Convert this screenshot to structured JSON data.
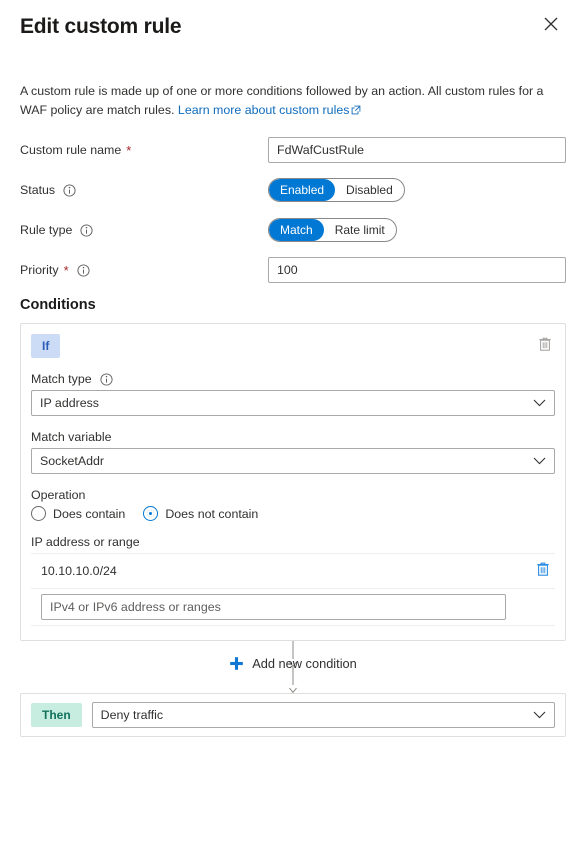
{
  "header": {
    "title": "Edit custom rule",
    "close_icon": "close-icon"
  },
  "intro": {
    "text_before": "A custom rule is made up of one or more conditions followed by an action. All custom rules for a WAF policy are match rules. ",
    "link_text": "Learn more about custom rules",
    "link_icon": "external-link-icon"
  },
  "form": {
    "rule_name": {
      "label": "Custom rule name",
      "required": "*",
      "value": "FdWafCustRule",
      "placeholder": ""
    },
    "status": {
      "label": "Status",
      "info_icon": "info-icon",
      "options": [
        "Enabled",
        "Disabled"
      ],
      "selected": "Enabled"
    },
    "rule_type": {
      "label": "Rule type",
      "info_icon": "info-icon",
      "options": [
        "Match",
        "Rate limit"
      ],
      "selected": "Match"
    },
    "priority": {
      "label": "Priority",
      "required": "*",
      "info_icon": "info-icon",
      "value": "100"
    }
  },
  "conditions": {
    "section_title": "Conditions",
    "if_badge": "If",
    "delete_icon": "trash-icon",
    "match_type": {
      "label": "Match type",
      "info_icon": "info-icon",
      "value": "IP address"
    },
    "match_variable": {
      "label": "Match variable",
      "value": "SocketAddr"
    },
    "operation": {
      "label": "Operation",
      "options": [
        "Does contain",
        "Does not contain"
      ],
      "selected": "Does not contain"
    },
    "ip_addresses": {
      "label": "IP address or range",
      "items": [
        "10.10.10.0/24"
      ],
      "item_delete_icon": "trash-icon",
      "new_placeholder": "IPv4 or IPv6 address or ranges",
      "new_value": ""
    }
  },
  "add_condition": {
    "label": "Add new condition",
    "icon": "plus-icon"
  },
  "then": {
    "badge": "Then",
    "action": "Deny traffic"
  },
  "colors": {
    "accent_blue": "#0078d4",
    "link_blue": "#0f6cbd",
    "if_badge_bg": "#ccdcf7",
    "if_badge_text": "#2b5cb8",
    "then_badge_bg": "#c7ede1",
    "then_badge_text": "#12725c",
    "required_red": "#a4262c",
    "border_grey": "#a9a9a9",
    "card_border": "#e1dfdd"
  }
}
